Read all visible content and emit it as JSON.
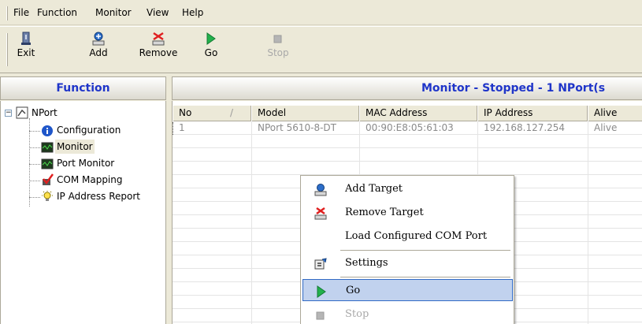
{
  "menubar": {
    "items": [
      "File",
      "Function",
      "Monitor",
      "View",
      "Help"
    ]
  },
  "toolbar": {
    "buttons": [
      {
        "label": "Exit",
        "icon": "exit-icon",
        "enabled": true
      },
      {
        "label": "Add",
        "icon": "add-icon",
        "enabled": true
      },
      {
        "label": "Remove",
        "icon": "remove-icon",
        "enabled": true
      },
      {
        "label": "Go",
        "icon": "go-icon",
        "enabled": true
      },
      {
        "label": "Stop",
        "icon": "stop-icon",
        "enabled": false
      }
    ]
  },
  "left_panel": {
    "title": "Function",
    "tree": {
      "root": "NPort",
      "children": [
        "Configuration",
        "Monitor",
        "Port Monitor",
        "COM Mapping",
        "IP Address Report"
      ],
      "selected": "Monitor"
    }
  },
  "right_panel": {
    "title": "Monitor - Stopped - 1 NPort(s",
    "columns": [
      "No",
      "Model",
      "MAC Address",
      "IP Address",
      "Alive"
    ],
    "sort_indicator": "/",
    "rows": [
      {
        "no": "1",
        "model": "NPort 5610-8-DT",
        "mac": "00:90:E8:05:61:03",
        "ip": "192.168.127.254",
        "alive": "Alive"
      }
    ]
  },
  "context_menu": {
    "items": [
      {
        "label": "Add Target",
        "icon": "add-target-icon",
        "enabled": true
      },
      {
        "label": "Remove Target",
        "icon": "remove-target-icon",
        "enabled": true
      },
      {
        "label": "Load Configured COM Port",
        "icon": "",
        "enabled": true
      },
      {
        "label": "Settings",
        "icon": "settings-icon",
        "enabled": true
      },
      {
        "label": "Go",
        "icon": "go-icon",
        "enabled": true,
        "highlighted": true
      },
      {
        "label": "Stop",
        "icon": "stop-icon",
        "enabled": false
      }
    ]
  },
  "colors": {
    "header_text": "#1f35c9",
    "highlight": "#c1d2ee",
    "highlight_border": "#316ac5"
  }
}
